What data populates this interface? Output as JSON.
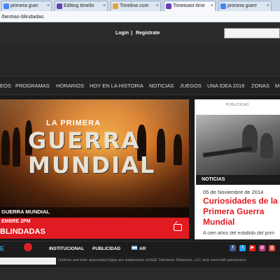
{
  "browser": {
    "tabs": [
      {
        "label": "primera guer",
        "icon": "google-icon",
        "color": "#4285f4"
      },
      {
        "label": "Editing timelin",
        "icon": "timetoast-icon",
        "color": "#6a3fb5"
      },
      {
        "label": "Timeline.com",
        "icon": "timeline-icon",
        "color": "#e2a43a"
      },
      {
        "label": "Timetoast time",
        "icon": "timetoast-icon",
        "color": "#6a3fb5"
      },
      {
        "label": "primera guerr",
        "icon": "google-icon",
        "color": "#4285f4"
      }
    ],
    "close_glyph": "×",
    "url": "/bestias-blindadas"
  },
  "header": {
    "login": "Login",
    "separator": "|",
    "register": "Registrate"
  },
  "nav": {
    "items": [
      "EOS",
      "PROGRAMAS",
      "HORARIOS",
      "HOY EN LA HISTORIA",
      "NOTICIAS",
      "JUEGOS",
      "UNA IDEA 2016",
      "ZONAS",
      "M"
    ]
  },
  "hero": {
    "title_line1": "LA PRIMERA",
    "title_line2": "GUERRA",
    "title_line3": "MUNDIAL",
    "caption": "GUERRA MUNDIAL",
    "schedule": "EMBRE 2PM",
    "show": "BLINDADAS"
  },
  "sidebar": {
    "ad_label": "PUBLICIDAD",
    "section_label": "NOTICIAS",
    "news_date": "05 de Noviembre de 2014",
    "news_title": "Curiosidades de la Primera Guerra Mundial",
    "news_excerpt": "A cien años del estallido del prim"
  },
  "footer": {
    "logo": "E",
    "links": [
      "INSTITUCIONAL",
      "PUBLICIDAD",
      "AR"
    ],
    "social": [
      {
        "name": "facebook-icon",
        "glyph": "f",
        "color": "#3b5998"
      },
      {
        "name": "twitter-icon",
        "glyph": "t",
        "color": "#1da1f2"
      },
      {
        "name": "youtube-icon",
        "glyph": "▶",
        "color": "#e62117"
      },
      {
        "name": "instagram-icon",
        "glyph": "◎",
        "color": "#c13584"
      },
      {
        "name": "googleplus-icon",
        "glyph": "g",
        "color": "#dd4b39"
      }
    ],
    "legal": "Lifetime and their associated logos are trademarks of A&E Television Networks, LLC and used with permission."
  },
  "colors": {
    "brand_red": "#e01b22",
    "dark_bg": "#262626"
  }
}
